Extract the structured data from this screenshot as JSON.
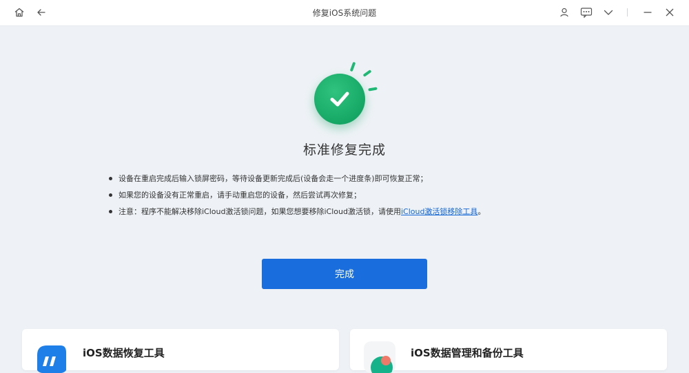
{
  "window": {
    "title": "修复iOS系统问题",
    "icons": {
      "home": "home-icon",
      "back": "back-arrow-icon",
      "account": "user-icon",
      "feedback": "message-icon",
      "menu": "chevron-down-icon",
      "minimize": "minimize-icon",
      "close": "close-icon"
    }
  },
  "main": {
    "status_icon": "success-check-icon",
    "heading": "标准修复完成",
    "notes": [
      {
        "text": "设备在重启完成后输入锁屏密码，等待设备更新完成后(设备会走一个进度条)即可恢复正常；"
      },
      {
        "text": "如果您的设备没有正常重启，请手动重启您的设备，然后尝试再次修复；"
      },
      {
        "text": "注意：程序不能解决移除iCloud激活锁问题，如果您想要移除iCloud激活锁，请使用",
        "link": "iCloud激活锁移除工具",
        "suffix": "。"
      }
    ],
    "done_button": "完成"
  },
  "cards": [
    {
      "title": "iOS数据恢复工具",
      "icon": "data-recovery-app-icon"
    },
    {
      "title": "iOS数据管理和备份工具",
      "icon": "data-backup-app-icon"
    }
  ],
  "colors": {
    "accent": "#1a6ddc",
    "success": "#1fb874",
    "link": "#1366d6",
    "background": "#eef2f6"
  }
}
